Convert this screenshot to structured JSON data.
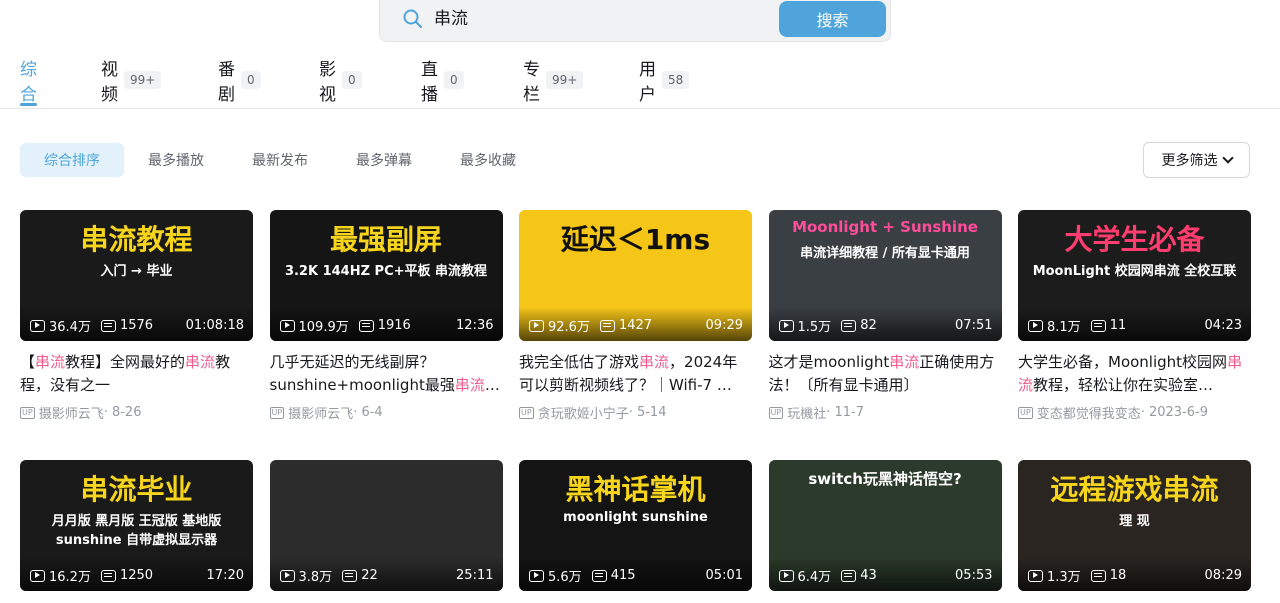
{
  "search": {
    "query": "串流",
    "button": "搜索"
  },
  "tabs": [
    {
      "label": "综合",
      "count": ""
    },
    {
      "label": "视频",
      "count": "99+"
    },
    {
      "label": "番剧",
      "count": "0"
    },
    {
      "label": "影视",
      "count": "0"
    },
    {
      "label": "直播",
      "count": "0"
    },
    {
      "label": "专栏",
      "count": "99+"
    },
    {
      "label": "用户",
      "count": "58"
    }
  ],
  "sorts": [
    "综合排序",
    "最多播放",
    "最新发布",
    "最多弹幕",
    "最多收藏"
  ],
  "more_filter": "更多筛选",
  "videos": [
    {
      "thumb_text": "串流教程",
      "thumb_sub": "入门 → 毕业",
      "plays": "36.4万",
      "danmaku": "1576",
      "duration": "01:08:18",
      "title_pre": "【",
      "title_hl": "串流",
      "title_mid": "教程】全网最好的",
      "title_hl2": "串流",
      "title_post": "教程，没有之一",
      "author": "摄影师云飞",
      "date": "8-26"
    },
    {
      "thumb_text": "最强副屏",
      "thumb_sub": "3.2K 144HZ  PC+平板 串流教程",
      "plays": "109.9万",
      "danmaku": "1916",
      "duration": "12:36",
      "title_pre": "几乎无延迟的无线副屏？sunshine+moonlight最强",
      "title_hl": "串流",
      "title_mid": "！【…",
      "title_hl2": "",
      "title_post": "",
      "author": "摄影师云飞",
      "date": "6-4"
    },
    {
      "thumb_text": "延迟＜1ms",
      "thumb_sub": "",
      "plays": "92.6万",
      "danmaku": "1427",
      "duration": "09:29",
      "title_pre": "我完全低估了游戏",
      "title_hl": "串流",
      "title_mid": "，2024年可以剪断视频线了？｜Wifi-7 …",
      "title_hl2": "",
      "title_post": "",
      "author": "贪玩歌姬小宁子",
      "date": "5-14"
    },
    {
      "thumb_text": "Moonlight + Sunshine",
      "thumb_sub": "串流详细教程 / 所有显卡通用",
      "plays": "1.5万",
      "danmaku": "82",
      "duration": "07:51",
      "title_pre": "这才是moonlight",
      "title_hl": "串流",
      "title_mid": "正确使用方法！〔所有显卡通用〕",
      "title_hl2": "",
      "title_post": "",
      "author": "玩機社",
      "date": "11-7"
    },
    {
      "thumb_text": "大学生必备",
      "thumb_sub": "MoonLight 校园网串流 全校互联",
      "plays": "8.1万",
      "danmaku": "11",
      "duration": "04:23",
      "title_pre": "大学生必备，Moonlight校园网",
      "title_hl": "串流",
      "title_mid": "教程，轻松让你在实验室…",
      "title_hl2": "",
      "title_post": "",
      "author": "变态都觉得我变态",
      "date": "2023-6-9"
    },
    {
      "thumb_text": "串流毕业",
      "thumb_sub": "月月版 黑月版 王冠版  基地版 sunshine 自带虚拟显示器",
      "plays": "16.2万",
      "danmaku": "1250",
      "duration": "17:20",
      "title_pre": "",
      "title_hl": "",
      "title_mid": "",
      "title_hl2": "",
      "title_post": "",
      "author": "",
      "date": ""
    },
    {
      "thumb_text": "",
      "thumb_sub": "",
      "plays": "3.8万",
      "danmaku": "22",
      "duration": "25:11",
      "title_pre": "",
      "title_hl": "",
      "title_mid": "",
      "title_hl2": "",
      "title_post": "",
      "author": "",
      "date": ""
    },
    {
      "thumb_text": "黑神话掌机",
      "thumb_sub": "moonlight  sunshine",
      "plays": "5.6万",
      "danmaku": "415",
      "duration": "05:01",
      "title_pre": "",
      "title_hl": "",
      "title_mid": "",
      "title_hl2": "",
      "title_post": "",
      "author": "",
      "date": ""
    },
    {
      "thumb_text": "switch玩黑神话悟空?",
      "thumb_sub": "",
      "plays": "6.4万",
      "danmaku": "43",
      "duration": "05:53",
      "title_pre": "",
      "title_hl": "",
      "title_mid": "",
      "title_hl2": "",
      "title_post": "",
      "author": "",
      "date": ""
    },
    {
      "thumb_text": "远程游戏串流",
      "thumb_sub": "理 现",
      "plays": "1.3万",
      "danmaku": "18",
      "duration": "08:29",
      "title_pre": "",
      "title_hl": "",
      "title_mid": "",
      "title_hl2": "",
      "title_post": "",
      "author": "",
      "date": ""
    }
  ],
  "colors": {
    "accent": "#4fa5db",
    "highlight": "#f25d8e"
  }
}
